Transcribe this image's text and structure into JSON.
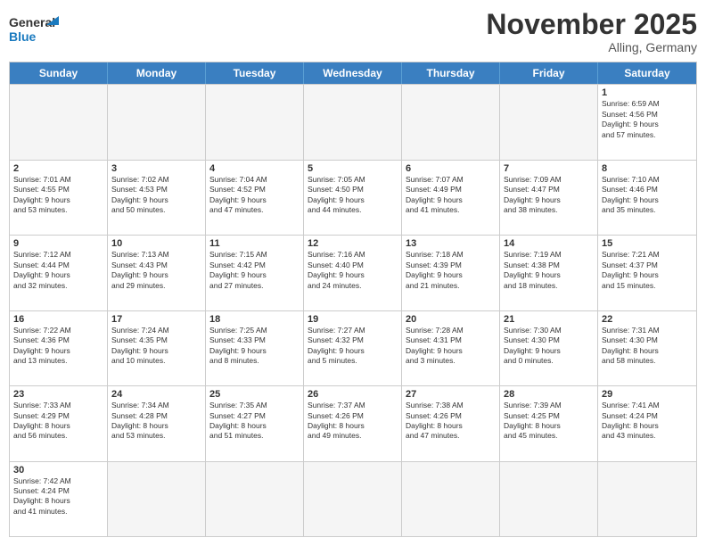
{
  "header": {
    "logo_general": "General",
    "logo_blue": "Blue",
    "month": "November 2025",
    "location": "Alling, Germany"
  },
  "days_of_week": [
    "Sunday",
    "Monday",
    "Tuesday",
    "Wednesday",
    "Thursday",
    "Friday",
    "Saturday"
  ],
  "weeks": [
    [
      {
        "day": "",
        "info": "",
        "empty": true
      },
      {
        "day": "",
        "info": "",
        "empty": true
      },
      {
        "day": "",
        "info": "",
        "empty": true
      },
      {
        "day": "",
        "info": "",
        "empty": true
      },
      {
        "day": "",
        "info": "",
        "empty": true
      },
      {
        "day": "",
        "info": "",
        "empty": true
      },
      {
        "day": "1",
        "info": "Sunrise: 6:59 AM\nSunset: 4:56 PM\nDaylight: 9 hours\nand 57 minutes.",
        "empty": false
      }
    ],
    [
      {
        "day": "2",
        "info": "Sunrise: 7:01 AM\nSunset: 4:55 PM\nDaylight: 9 hours\nand 53 minutes.",
        "empty": false
      },
      {
        "day": "3",
        "info": "Sunrise: 7:02 AM\nSunset: 4:53 PM\nDaylight: 9 hours\nand 50 minutes.",
        "empty": false
      },
      {
        "day": "4",
        "info": "Sunrise: 7:04 AM\nSunset: 4:52 PM\nDaylight: 9 hours\nand 47 minutes.",
        "empty": false
      },
      {
        "day": "5",
        "info": "Sunrise: 7:05 AM\nSunset: 4:50 PM\nDaylight: 9 hours\nand 44 minutes.",
        "empty": false
      },
      {
        "day": "6",
        "info": "Sunrise: 7:07 AM\nSunset: 4:49 PM\nDaylight: 9 hours\nand 41 minutes.",
        "empty": false
      },
      {
        "day": "7",
        "info": "Sunrise: 7:09 AM\nSunset: 4:47 PM\nDaylight: 9 hours\nand 38 minutes.",
        "empty": false
      },
      {
        "day": "8",
        "info": "Sunrise: 7:10 AM\nSunset: 4:46 PM\nDaylight: 9 hours\nand 35 minutes.",
        "empty": false
      }
    ],
    [
      {
        "day": "9",
        "info": "Sunrise: 7:12 AM\nSunset: 4:44 PM\nDaylight: 9 hours\nand 32 minutes.",
        "empty": false
      },
      {
        "day": "10",
        "info": "Sunrise: 7:13 AM\nSunset: 4:43 PM\nDaylight: 9 hours\nand 29 minutes.",
        "empty": false
      },
      {
        "day": "11",
        "info": "Sunrise: 7:15 AM\nSunset: 4:42 PM\nDaylight: 9 hours\nand 27 minutes.",
        "empty": false
      },
      {
        "day": "12",
        "info": "Sunrise: 7:16 AM\nSunset: 4:40 PM\nDaylight: 9 hours\nand 24 minutes.",
        "empty": false
      },
      {
        "day": "13",
        "info": "Sunrise: 7:18 AM\nSunset: 4:39 PM\nDaylight: 9 hours\nand 21 minutes.",
        "empty": false
      },
      {
        "day": "14",
        "info": "Sunrise: 7:19 AM\nSunset: 4:38 PM\nDaylight: 9 hours\nand 18 minutes.",
        "empty": false
      },
      {
        "day": "15",
        "info": "Sunrise: 7:21 AM\nSunset: 4:37 PM\nDaylight: 9 hours\nand 15 minutes.",
        "empty": false
      }
    ],
    [
      {
        "day": "16",
        "info": "Sunrise: 7:22 AM\nSunset: 4:36 PM\nDaylight: 9 hours\nand 13 minutes.",
        "empty": false
      },
      {
        "day": "17",
        "info": "Sunrise: 7:24 AM\nSunset: 4:35 PM\nDaylight: 9 hours\nand 10 minutes.",
        "empty": false
      },
      {
        "day": "18",
        "info": "Sunrise: 7:25 AM\nSunset: 4:33 PM\nDaylight: 9 hours\nand 8 minutes.",
        "empty": false
      },
      {
        "day": "19",
        "info": "Sunrise: 7:27 AM\nSunset: 4:32 PM\nDaylight: 9 hours\nand 5 minutes.",
        "empty": false
      },
      {
        "day": "20",
        "info": "Sunrise: 7:28 AM\nSunset: 4:31 PM\nDaylight: 9 hours\nand 3 minutes.",
        "empty": false
      },
      {
        "day": "21",
        "info": "Sunrise: 7:30 AM\nSunset: 4:30 PM\nDaylight: 9 hours\nand 0 minutes.",
        "empty": false
      },
      {
        "day": "22",
        "info": "Sunrise: 7:31 AM\nSunset: 4:30 PM\nDaylight: 8 hours\nand 58 minutes.",
        "empty": false
      }
    ],
    [
      {
        "day": "23",
        "info": "Sunrise: 7:33 AM\nSunset: 4:29 PM\nDaylight: 8 hours\nand 56 minutes.",
        "empty": false
      },
      {
        "day": "24",
        "info": "Sunrise: 7:34 AM\nSunset: 4:28 PM\nDaylight: 8 hours\nand 53 minutes.",
        "empty": false
      },
      {
        "day": "25",
        "info": "Sunrise: 7:35 AM\nSunset: 4:27 PM\nDaylight: 8 hours\nand 51 minutes.",
        "empty": false
      },
      {
        "day": "26",
        "info": "Sunrise: 7:37 AM\nSunset: 4:26 PM\nDaylight: 8 hours\nand 49 minutes.",
        "empty": false
      },
      {
        "day": "27",
        "info": "Sunrise: 7:38 AM\nSunset: 4:26 PM\nDaylight: 8 hours\nand 47 minutes.",
        "empty": false
      },
      {
        "day": "28",
        "info": "Sunrise: 7:39 AM\nSunset: 4:25 PM\nDaylight: 8 hours\nand 45 minutes.",
        "empty": false
      },
      {
        "day": "29",
        "info": "Sunrise: 7:41 AM\nSunset: 4:24 PM\nDaylight: 8 hours\nand 43 minutes.",
        "empty": false
      }
    ],
    [
      {
        "day": "30",
        "info": "Sunrise: 7:42 AM\nSunset: 4:24 PM\nDaylight: 8 hours\nand 41 minutes.",
        "empty": false
      },
      {
        "day": "",
        "info": "",
        "empty": true
      },
      {
        "day": "",
        "info": "",
        "empty": true
      },
      {
        "day": "",
        "info": "",
        "empty": true
      },
      {
        "day": "",
        "info": "",
        "empty": true
      },
      {
        "day": "",
        "info": "",
        "empty": true
      },
      {
        "day": "",
        "info": "",
        "empty": true
      }
    ]
  ]
}
